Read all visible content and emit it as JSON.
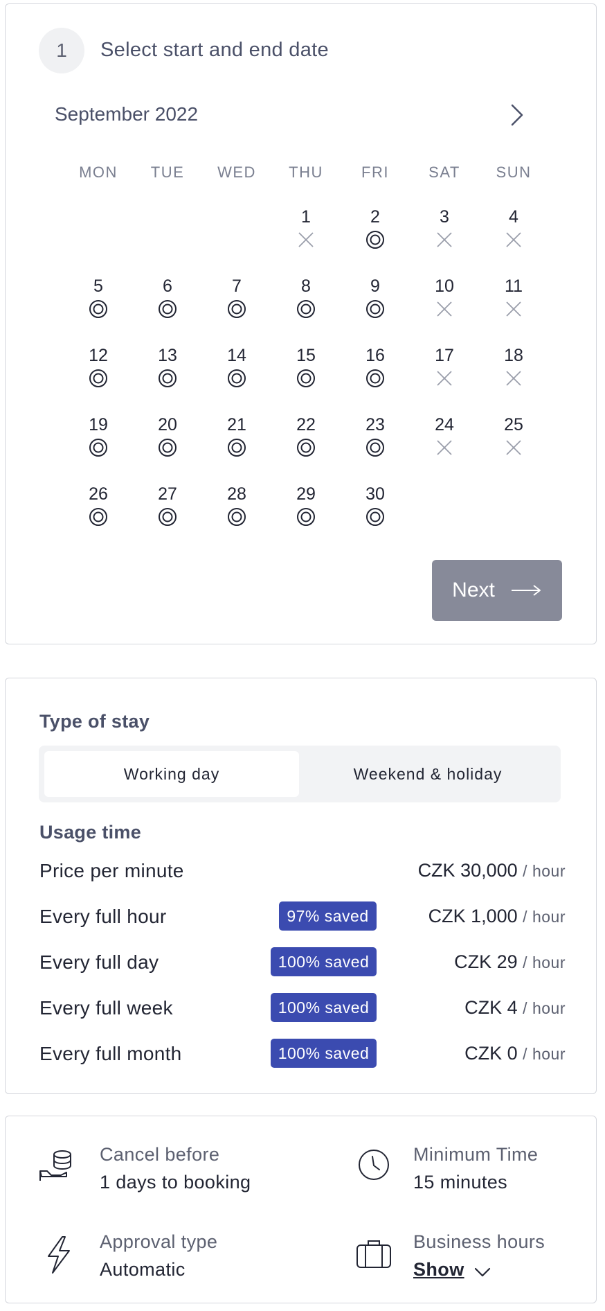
{
  "booking": {
    "step_number": "1",
    "step_title": "Select start and end date",
    "month": "September 2022",
    "weekdays": [
      "MON",
      "TUE",
      "WED",
      "THU",
      "FRI",
      "SAT",
      "SUN"
    ],
    "days": [
      {
        "d": "1",
        "s": "unavailable"
      },
      {
        "d": "2",
        "s": "available"
      },
      {
        "d": "3",
        "s": "unavailable"
      },
      {
        "d": "4",
        "s": "unavailable"
      },
      {
        "d": "5",
        "s": "available"
      },
      {
        "d": "6",
        "s": "available"
      },
      {
        "d": "7",
        "s": "available"
      },
      {
        "d": "8",
        "s": "available"
      },
      {
        "d": "9",
        "s": "available"
      },
      {
        "d": "10",
        "s": "unavailable"
      },
      {
        "d": "11",
        "s": "unavailable"
      },
      {
        "d": "12",
        "s": "available"
      },
      {
        "d": "13",
        "s": "available"
      },
      {
        "d": "14",
        "s": "available"
      },
      {
        "d": "15",
        "s": "available"
      },
      {
        "d": "16",
        "s": "available"
      },
      {
        "d": "17",
        "s": "unavailable"
      },
      {
        "d": "18",
        "s": "unavailable"
      },
      {
        "d": "19",
        "s": "available"
      },
      {
        "d": "20",
        "s": "available"
      },
      {
        "d": "21",
        "s": "available"
      },
      {
        "d": "22",
        "s": "available"
      },
      {
        "d": "23",
        "s": "available"
      },
      {
        "d": "24",
        "s": "unavailable"
      },
      {
        "d": "25",
        "s": "unavailable"
      },
      {
        "d": "26",
        "s": "available"
      },
      {
        "d": "27",
        "s": "available"
      },
      {
        "d": "28",
        "s": "available"
      },
      {
        "d": "29",
        "s": "available"
      },
      {
        "d": "30",
        "s": "available"
      }
    ],
    "next_label": "Next"
  },
  "stay": {
    "title": "Type of stay",
    "options": [
      "Working day",
      "Weekend & holiday"
    ],
    "selected": "Working day",
    "usage_title": "Usage time",
    "rows": [
      {
        "label": "Price per minute",
        "badge": "",
        "price": "CZK 30,000",
        "unit": "/ hour"
      },
      {
        "label": "Every full hour",
        "badge": "97% saved",
        "price": "CZK 1,000",
        "unit": "/ hour"
      },
      {
        "label": "Every full day",
        "badge": "100% saved",
        "price": "CZK 29",
        "unit": "/ hour"
      },
      {
        "label": "Every full week",
        "badge": "100% saved",
        "price": "CZK 4",
        "unit": "/ hour"
      },
      {
        "label": "Every full month",
        "badge": "100% saved",
        "price": "CZK 0",
        "unit": "/ hour"
      }
    ]
  },
  "info": {
    "cancel_label": "Cancel before",
    "cancel_value": "1 days to booking",
    "min_label": "Minimum Time",
    "min_value": "15 minutes",
    "approval_label": "Approval type",
    "approval_value": "Automatic",
    "hours_label": "Business hours",
    "hours_link": "Show"
  },
  "colors": {
    "accent_badge": "#3b4bb0",
    "button_disabled": "#878a99",
    "muted_text": "#5c6070"
  },
  "icons": {
    "next_month": "chevron-right-icon",
    "available": "double-circle-icon",
    "unavailable": "cross-icon",
    "next_arrow": "long-arrow-right-icon",
    "cancel": "coins-hand-icon",
    "min_time": "clock-icon",
    "approval": "lightning-icon",
    "hours": "briefcase-icon",
    "hours_toggle": "chevron-down-icon"
  }
}
